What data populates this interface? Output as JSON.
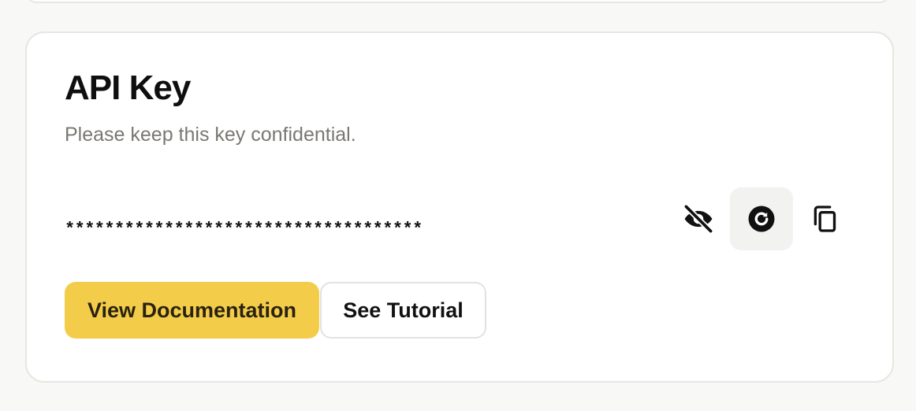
{
  "card": {
    "title": "API Key",
    "subtitle": "Please keep this key confidential.",
    "key_masked": "************************************"
  },
  "actions": {
    "toggle_visibility_icon": "eye-off-icon",
    "regenerate_icon": "refresh-icon",
    "copy_icon": "copy-icon"
  },
  "buttons": {
    "documentation_label": "View Documentation",
    "tutorial_label": "See Tutorial"
  },
  "colors": {
    "primary_button": "#f3cd4a",
    "primary_button_text": "#2a2210",
    "subtitle_text": "#7a7872",
    "active_icon_bg": "#f2f2f0"
  }
}
